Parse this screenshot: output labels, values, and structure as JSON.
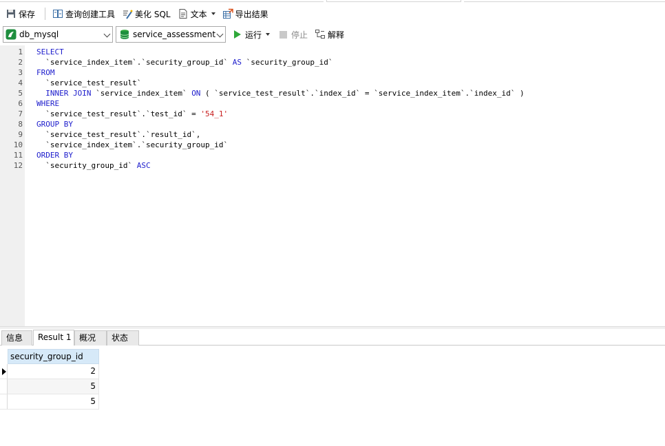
{
  "toolbar": {
    "save": "保存",
    "query_builder": "查询创建工具",
    "beautify_sql": "美化 SQL",
    "text": "文本",
    "export": "导出结果"
  },
  "connection_bar": {
    "connection": "db_mysql",
    "database": "service_assessment",
    "run": "运行",
    "stop": "停止",
    "explain": "解释"
  },
  "editor": {
    "lines": [
      {
        "n": "1",
        "parts": [
          {
            "t": "SELECT",
            "c": "kw"
          }
        ]
      },
      {
        "n": "2",
        "parts": [
          {
            "t": "  `service_index_item`.`security_group_id` ",
            "c": ""
          },
          {
            "t": "AS",
            "c": "kw"
          },
          {
            "t": " `security_group_id`",
            "c": ""
          }
        ]
      },
      {
        "n": "3",
        "parts": [
          {
            "t": "FROM",
            "c": "kw"
          }
        ]
      },
      {
        "n": "4",
        "parts": [
          {
            "t": "  `service_test_result`",
            "c": ""
          }
        ]
      },
      {
        "n": "5",
        "parts": [
          {
            "t": "  ",
            "c": ""
          },
          {
            "t": "INNER JOIN",
            "c": "kw"
          },
          {
            "t": " `service_index_item` ",
            "c": ""
          },
          {
            "t": "ON",
            "c": "kw"
          },
          {
            "t": " ( `service_test_result`.`index_id` = `service_index_item`.`index_id` )",
            "c": ""
          }
        ]
      },
      {
        "n": "6",
        "parts": [
          {
            "t": "WHERE",
            "c": "kw"
          }
        ]
      },
      {
        "n": "7",
        "parts": [
          {
            "t": "  `service_test_result`.`test_id` = ",
            "c": ""
          },
          {
            "t": "'54_1'",
            "c": "str"
          }
        ]
      },
      {
        "n": "8",
        "parts": [
          {
            "t": "GROUP BY",
            "c": "kw"
          }
        ]
      },
      {
        "n": "9",
        "parts": [
          {
            "t": "  `service_test_result`.`result_id`,",
            "c": ""
          }
        ]
      },
      {
        "n": "10",
        "parts": [
          {
            "t": "  `service_index_item`.`security_group_id`",
            "c": ""
          }
        ]
      },
      {
        "n": "11",
        "parts": [
          {
            "t": "ORDER BY",
            "c": "kw"
          }
        ]
      },
      {
        "n": "12",
        "parts": [
          {
            "t": "  `security_group_id` ",
            "c": ""
          },
          {
            "t": "ASC",
            "c": "kw"
          }
        ]
      }
    ]
  },
  "result_tabs": [
    "信息",
    "Result 1",
    "概况",
    "状态"
  ],
  "active_tab": "Result 1",
  "grid": {
    "column": "security_group_id",
    "rows": [
      "2",
      "5",
      "5"
    ]
  },
  "colors": {
    "keyword": "#1c1ccc",
    "string": "#c81e1e",
    "header": "#d6e9f8",
    "run_green": "#2fa83a",
    "db_green": "#1e8e3e"
  }
}
